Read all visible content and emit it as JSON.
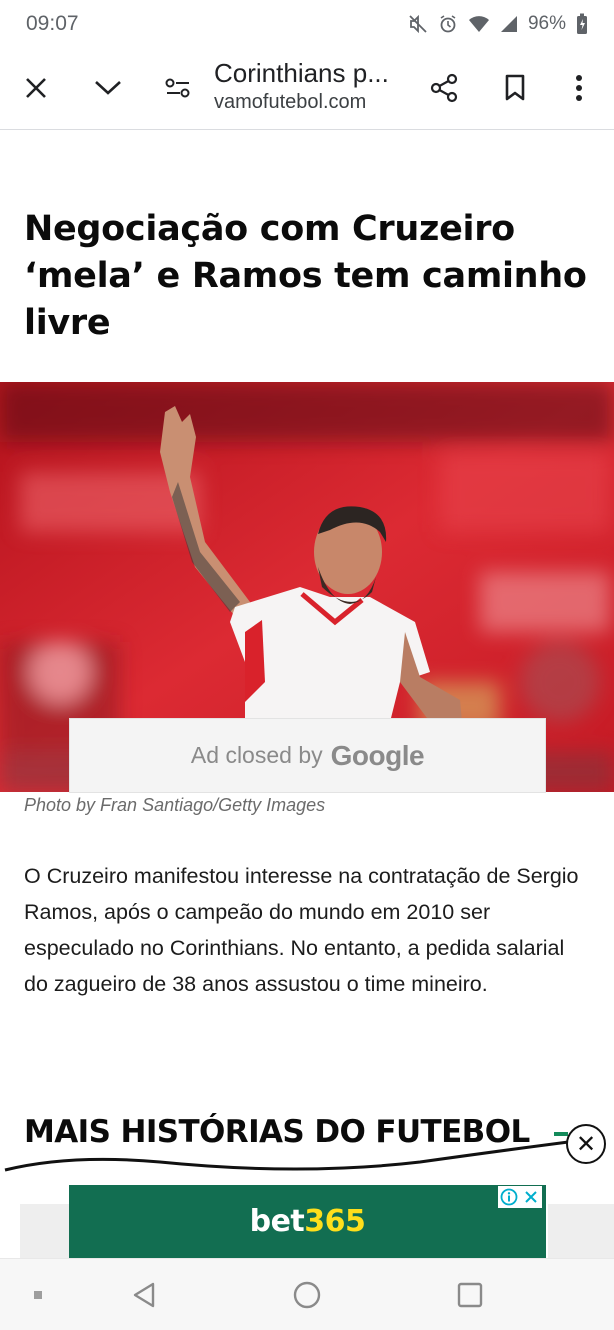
{
  "status_bar": {
    "time": "09:07",
    "battery": "96%"
  },
  "toolbar": {
    "page_title": "Corinthians p...",
    "url": "vamofutebol.com"
  },
  "article": {
    "headline": "Negociação com Cruzeiro ‘mela’ e Ramos tem caminho livre",
    "ad_closed_prefix": "Ad closed by",
    "ad_closed_brand": "Google",
    "photo_caption": "Photo by Fran Santiago/Getty Images",
    "body": "O Cruzeiro manifestou interesse na contratação de Sergio Ramos, após o campeão do mundo em 2010 ser especulado no Corinthians. No entanto, a pedida salarial do zagueiro de 38 anos assustou o time mineiro.",
    "section_heading": "MAIS HISTÓRIAS DO FUTEBOL"
  },
  "bottom_ad": {
    "brand_part1": "bet",
    "brand_part2": "365",
    "close_label": "✕"
  },
  "colors": {
    "bet_green": "#126e51",
    "bet_yellow": "#ffdf1b",
    "stadium_red": "#d9232c"
  }
}
